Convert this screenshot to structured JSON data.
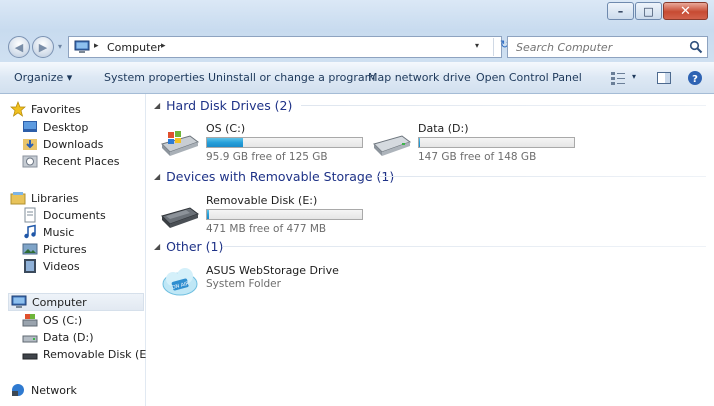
{
  "window": {
    "minimize_glyph": "–",
    "maximize_glyph": "□",
    "close_glyph": "✕"
  },
  "address": {
    "back_glyph": "◀",
    "forward_glyph": "▶",
    "location": "Computer",
    "separator": "▸",
    "dropdown_glyph": "▾",
    "refresh_glyph": "↻",
    "search_placeholder": "Search Computer"
  },
  "commands": {
    "organize": "Organize ▾",
    "system_properties": "System properties",
    "uninstall": "Uninstall or change a program",
    "map_drive": "Map network drive",
    "open_control_panel": "Open Control Panel",
    "view_dropdown": "▾"
  },
  "nav": {
    "favorites": "Favorites",
    "desktop": "Desktop",
    "downloads": "Downloads",
    "recent": "Recent Places",
    "libraries": "Libraries",
    "documents": "Documents",
    "music": "Music",
    "pictures": "Pictures",
    "videos": "Videos",
    "computer": "Computer",
    "os_c": "OS (C:)",
    "data_d": "Data (D:)",
    "removable_e": "Removable Disk (E:)",
    "network": "Network"
  },
  "groups": {
    "hdd": "Hard Disk Drives (2)",
    "removable": "Devices with Removable Storage (1)",
    "other": "Other (1)",
    "collapse_glyph": "◢"
  },
  "drives": {
    "c": {
      "name": "OS (C:)",
      "space": "95.9 GB free of 125 GB",
      "used_fraction": 0.233
    },
    "d": {
      "name": "Data (D:)",
      "space": "147 GB free of 148 GB",
      "used_fraction": 0.007
    },
    "e": {
      "name": "Removable Disk (E:)",
      "space": "471 MB free of 477 MB",
      "used_fraction": 0.013
    }
  },
  "other_items": {
    "asus": {
      "name": "ASUS WebStorage Drive",
      "type": "System Folder"
    }
  },
  "colors": {
    "group_title": "#1e3287",
    "bar_fill": "#26a0da",
    "command_text": "#1e395b"
  }
}
